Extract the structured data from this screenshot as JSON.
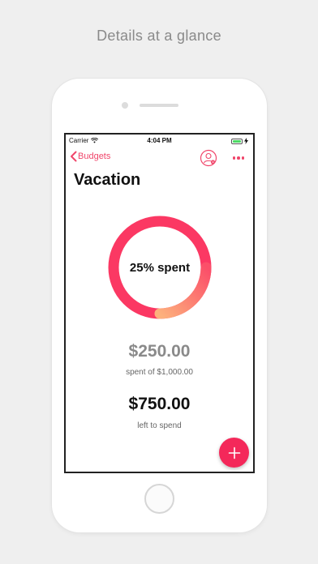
{
  "headline": "Details at a glance",
  "status_bar": {
    "carrier": "Carrier",
    "time": "4:04 PM",
    "icons": [
      "wifi-icon",
      "battery-icon",
      "charging-icon"
    ]
  },
  "nav": {
    "back_label": "Budgets",
    "back_icon": "chevron-left-icon",
    "profile_icon": "person-icon",
    "more_icon": "ellipsis-icon"
  },
  "budget": {
    "name": "Vacation",
    "progress_label": "25% spent",
    "progress_fraction": 0.25,
    "spent_amount": "$250.00",
    "spent_caption": "spent of $1,000.00",
    "remaining_amount": "$750.00",
    "remaining_caption": "left to spend"
  },
  "fab_icon": "plus-icon",
  "colors": {
    "accent": "#f0456a",
    "ring_remaining": "#fb3863",
    "ring_spent_start": "#fb4f69",
    "ring_spent_end": "#fdb07c",
    "fab": "#f4285a"
  }
}
